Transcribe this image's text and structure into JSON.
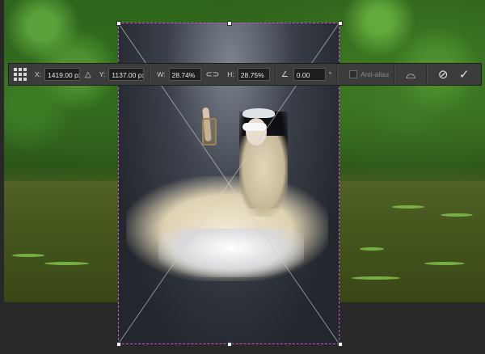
{
  "options_bar": {
    "reference_point_icon": "reference-point-grid-icon",
    "x_label": "X:",
    "x_value": "1419.00 px",
    "delta_icon": "relative-position-triangle-icon",
    "y_label": "Y:",
    "y_value": "1137.00 px",
    "w_label": "W:",
    "w_value": "28.74%",
    "link_icon": "chain-link-icon",
    "h_label": "H:",
    "h_value": "28.75%",
    "angle_icon": "angle-icon",
    "angle_value": "0.00",
    "degree_symbol": "°",
    "antialias_label": "Anti-alias",
    "warp_icon": "warp-mode-icon",
    "cancel_icon": "cancel-transform-icon",
    "commit_icon": "commit-transform-checkmark-icon"
  },
  "colors": {
    "transform_frame": "#d44fd8",
    "toolbar_bg": "#3c3c3c",
    "canvas_bg": "#282828"
  }
}
